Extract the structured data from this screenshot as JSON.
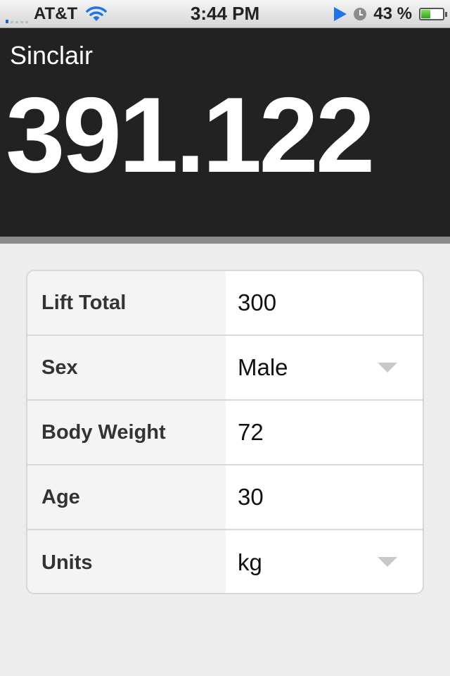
{
  "status_bar": {
    "carrier": "AT&T",
    "time": "3:44 PM",
    "battery_percent": "43 %",
    "battery_level": 0.43,
    "signal_bars": 1,
    "icons": [
      "signal-icon",
      "wifi-icon",
      "location-icon",
      "alarm-clock-icon",
      "battery-icon"
    ]
  },
  "result": {
    "label": "Sinclair",
    "value": "391.122"
  },
  "form": {
    "rows": [
      {
        "label": "Lift Total",
        "value": "300",
        "type": "input"
      },
      {
        "label": "Sex",
        "value": "Male",
        "type": "select"
      },
      {
        "label": "Body Weight",
        "value": "72",
        "type": "input"
      },
      {
        "label": "Age",
        "value": "30",
        "type": "input"
      },
      {
        "label": "Units",
        "value": "kg",
        "type": "select"
      }
    ]
  },
  "colors": {
    "header_bg": "#222222",
    "page_bg": "#ededed",
    "accent_blue": "#1e74e8",
    "battery_green": "#32a520"
  }
}
